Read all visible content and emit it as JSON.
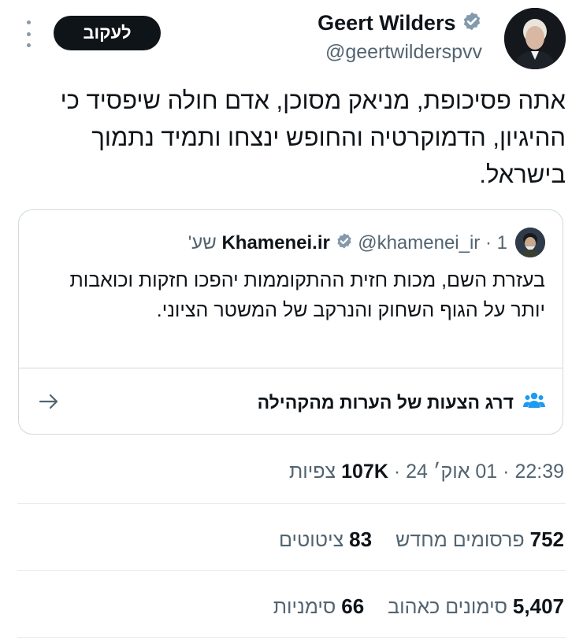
{
  "author": {
    "name": "Geert Wilders",
    "handle": "@geertwilderspvv"
  },
  "follow_label": "לעקוב",
  "tweet_text": "אתה פסיכופת, מניאק מסוכן, אדם חולה שיפסיד כי ההיגיון, הדמוקרטיה והחופש ינצחו ותמיד נתמוך בישראל.",
  "quote": {
    "name": "Khamenei.ir",
    "handle": "@khamenei_ir",
    "meta": "· 1 שע'",
    "text": "בעזרת השם, מכות חזית ההתקוממות יהפכו חזקות וכואבות יותר על הגוף השחוק והנרקב של המשטר הציוני.",
    "community_notes": "דרג הצעות של הערות מהקהילה"
  },
  "timestamp": {
    "time": "22:39",
    "date": "01 אוק׳ 24",
    "views_count": "107K",
    "views_label": "צפיות"
  },
  "stats": {
    "reposts_count": "752",
    "reposts_label": "פרסומים מחדש",
    "quotes_count": "83",
    "quotes_label": "ציטוטים",
    "likes_count": "5,407",
    "likes_label": "סימונים כאהוב",
    "bookmarks_count": "66",
    "bookmarks_label": "סימניות"
  },
  "colors": {
    "verified": "#829aab",
    "community_icon": "#1d9bf0",
    "text_secondary": "#536471"
  }
}
